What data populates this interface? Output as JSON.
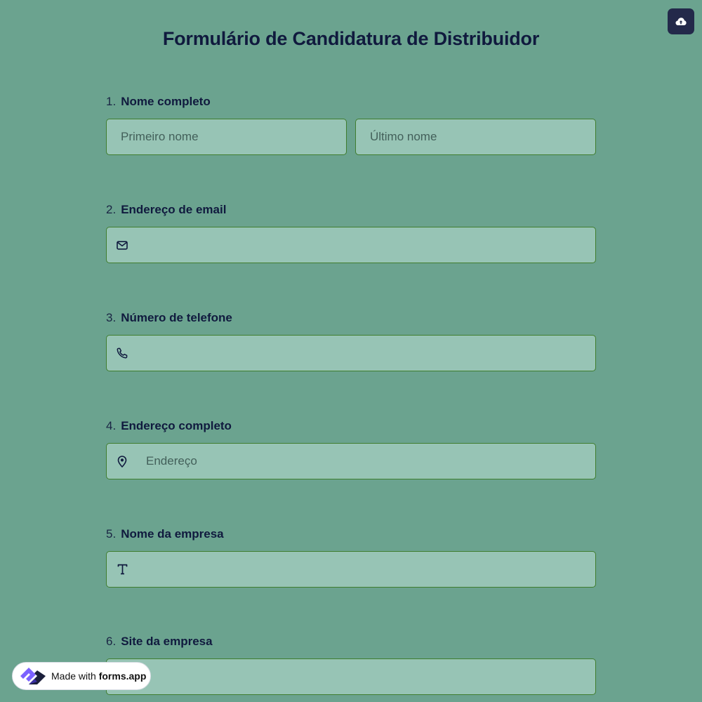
{
  "form": {
    "title": "Formulário de Candidatura de Distribuidor"
  },
  "colors": {
    "page_background": "#6ba38f",
    "field_background": "#97c4b5",
    "field_border": "#3f7d2e",
    "title_text": "#101a3e",
    "upload_button": "#23294a"
  },
  "toolbar": {
    "upload_icon": "cloud-upload-icon"
  },
  "questions": [
    {
      "number": "1.",
      "label": "Nome completo",
      "fields": [
        {
          "placeholder": "Primeiro nome",
          "value": ""
        },
        {
          "placeholder": "Último nome",
          "value": ""
        }
      ]
    },
    {
      "number": "2.",
      "label": "Endereço de email",
      "icon": "envelope-icon",
      "placeholder": "",
      "value": ""
    },
    {
      "number": "3.",
      "label": "Número de telefone",
      "icon": "phone-icon",
      "placeholder": "",
      "value": ""
    },
    {
      "number": "4.",
      "label": "Endereço completo",
      "icon": "location-pin-icon",
      "placeholder": "Endereço",
      "value": ""
    },
    {
      "number": "5.",
      "label": "Nome da empresa",
      "icon": "text-icon",
      "placeholder": "",
      "value": ""
    },
    {
      "number": "6.",
      "label": "Site da empresa",
      "placeholder": "",
      "value": ""
    }
  ],
  "badge": {
    "made_with": "Made with",
    "brand": "forms.app",
    "logo_icon": "forms-app-logo-icon"
  }
}
